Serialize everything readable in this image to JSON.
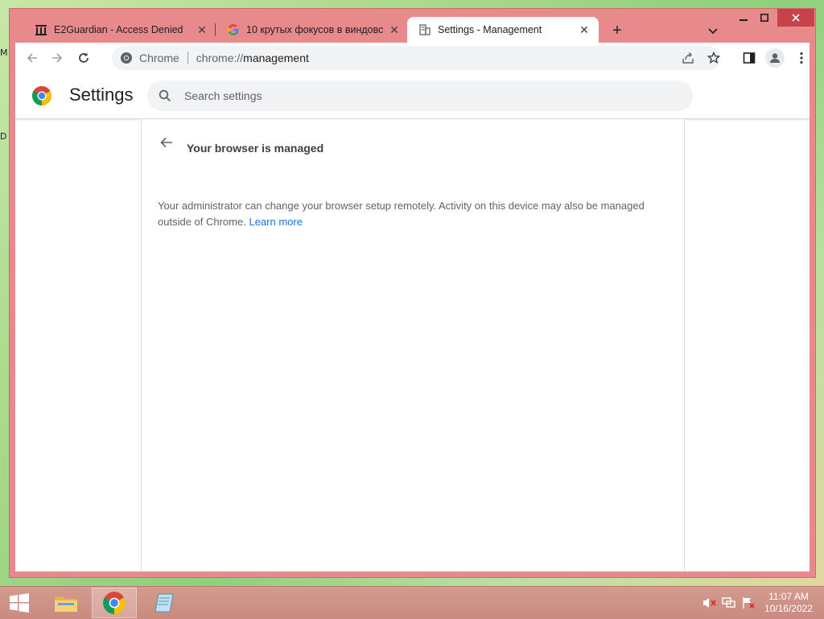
{
  "desktop": {
    "glyph_top": "M",
    "glyph_mid": "D"
  },
  "tabs": [
    {
      "title": "E2Guardian - Access Denied",
      "icon": "building-icon",
      "active": false
    },
    {
      "title": "10 крутых фокусов в виндовс -",
      "icon": "google-icon",
      "active": false
    },
    {
      "title": "Settings - Management",
      "icon": "building-icon",
      "active": true
    }
  ],
  "toolbar": {
    "omnibox_chip": "Chrome",
    "url_scheme": "chrome://",
    "url_path": "management"
  },
  "settings": {
    "title": "Settings",
    "search_placeholder": "Search settings"
  },
  "management": {
    "heading": "Your browser is managed",
    "description": "Your administrator can change your browser setup remotely. Activity on this device may also be managed outside of Chrome.",
    "learn_more": "Learn more"
  },
  "taskbar": {
    "clock_time": "11:07 AM",
    "clock_date": "10/16/2022"
  },
  "colors": {
    "frame": "#e8898b",
    "link": "#1a73e8",
    "taskbar": "#c98a80"
  }
}
